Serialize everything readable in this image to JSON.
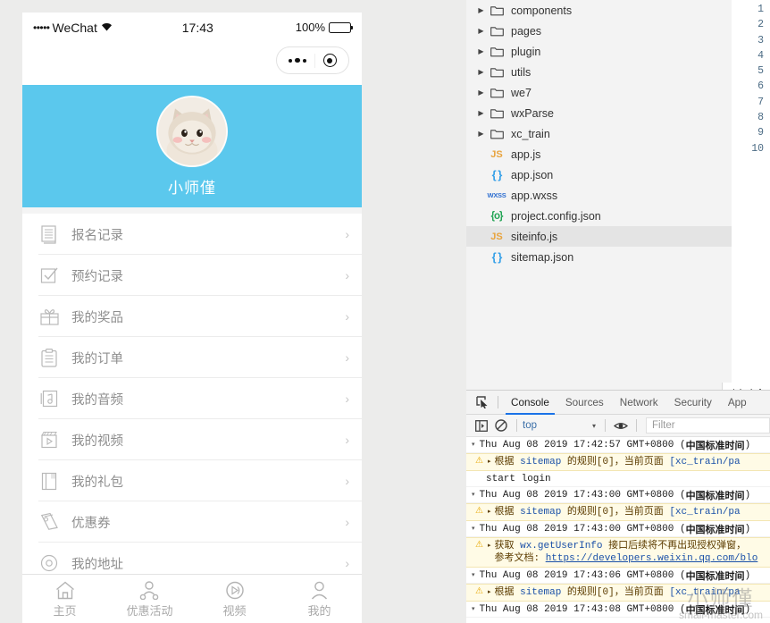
{
  "colors": {
    "accent_blue": "#5bc8ed",
    "devtools_active": "#1a73e8",
    "js_icon": "#e8a33d",
    "json_icon": "#35a0e8",
    "wxss_icon": "#2f6fd0",
    "config_icon": "#23a455",
    "warn_bg": "#fffbe6"
  },
  "phone": {
    "statusbar": {
      "signal_dots": "•••••",
      "carrier": "WeChat",
      "wifi_icon": "wifi-icon",
      "time": "17:43",
      "battery_percent": "100%",
      "battery_icon": "battery-icon"
    },
    "capsule": {
      "more_icon": "more-dots-icon",
      "target_icon": "target-circle-icon"
    },
    "profile": {
      "avatar_icon": "cat-avatar",
      "nickname": "小师僅"
    },
    "menu": [
      {
        "icon": "list-book-icon",
        "label": "报名记录",
        "arrow": "›"
      },
      {
        "icon": "checkbox-check-icon",
        "label": "预约记录",
        "arrow": "›"
      },
      {
        "icon": "gift-icon",
        "label": "我的奖品",
        "arrow": "›"
      },
      {
        "icon": "clipboard-icon",
        "label": "我的订单",
        "arrow": "›"
      },
      {
        "icon": "audio-note-icon",
        "label": "我的音频",
        "arrow": "›"
      },
      {
        "icon": "video-clapper-icon",
        "label": "我的视频",
        "arrow": "›"
      },
      {
        "icon": "gift-bag-icon",
        "label": "我的礼包",
        "arrow": "›"
      },
      {
        "icon": "coupon-icon",
        "label": "优惠券",
        "arrow": "›"
      },
      {
        "icon": "location-icon",
        "label": "我的地址",
        "arrow": "›"
      }
    ],
    "tabbar": [
      {
        "icon": "home-icon",
        "label": "主页"
      },
      {
        "icon": "people-share-icon",
        "label": "优惠活动"
      },
      {
        "icon": "video-play-icon",
        "label": "视频"
      },
      {
        "icon": "person-icon",
        "label": "我的"
      }
    ]
  },
  "ide": {
    "filetree": [
      {
        "type": "folder",
        "icon": "folder-icon",
        "name": "components",
        "expandable": true,
        "selected": false
      },
      {
        "type": "folder",
        "icon": "folder-icon",
        "name": "pages",
        "expandable": true,
        "selected": false
      },
      {
        "type": "folder",
        "icon": "folder-icon",
        "name": "plugin",
        "expandable": true,
        "selected": false
      },
      {
        "type": "folder",
        "icon": "folder-icon",
        "name": "utils",
        "expandable": true,
        "selected": false
      },
      {
        "type": "folder",
        "icon": "folder-icon",
        "name": "we7",
        "expandable": true,
        "selected": false
      },
      {
        "type": "folder",
        "icon": "folder-icon",
        "name": "wxParse",
        "expandable": true,
        "selected": false
      },
      {
        "type": "folder",
        "icon": "folder-icon",
        "name": "xc_train",
        "expandable": true,
        "selected": false
      },
      {
        "type": "js",
        "icon": "js-file-icon",
        "badge": "JS",
        "name": "app.js",
        "expandable": false,
        "selected": false
      },
      {
        "type": "json",
        "icon": "json-file-icon",
        "badge": "{ }",
        "name": "app.json",
        "expandable": false,
        "selected": false
      },
      {
        "type": "wxss",
        "icon": "wxss-file-icon",
        "badge": "WXSS",
        "name": "app.wxss",
        "expandable": false,
        "selected": false
      },
      {
        "type": "config",
        "icon": "config-file-icon",
        "badge": "{o}",
        "name": "project.config.json",
        "expandable": false,
        "selected": false
      },
      {
        "type": "js",
        "icon": "js-file-icon",
        "badge": "JS",
        "name": "siteinfo.js",
        "expandable": false,
        "selected": true
      },
      {
        "type": "json",
        "icon": "json-file-icon",
        "badge": "{ }",
        "name": "sitemap.json",
        "expandable": false,
        "selected": false
      }
    ],
    "gutter_lines": [
      "1",
      "2",
      "3",
      "4",
      "5",
      "6",
      "7",
      "8",
      "9",
      "10"
    ],
    "editor_tab": "/siteinf"
  },
  "devtools": {
    "inspect_icon": "inspect-element-icon",
    "tabs": [
      {
        "label": "Console",
        "active": true
      },
      {
        "label": "Sources",
        "active": false
      },
      {
        "label": "Network",
        "active": false
      },
      {
        "label": "Security",
        "active": false
      },
      {
        "label": "App",
        "active": false
      }
    ],
    "filterbar": {
      "sidebar_icon": "console-sidebar-icon",
      "clear_icon": "clear-console-icon",
      "context": "top",
      "context_caret": "▾",
      "eye_icon": "live-expression-icon",
      "filter_placeholder": "Filter"
    },
    "console_entries": [
      {
        "kind": "group",
        "caret": "▾",
        "date": "Thu Aug 08 2019 17:42:57 GMT+0800 (",
        "tz": "中国标准时间",
        "tail": ")"
      },
      {
        "kind": "warn",
        "icon": "warning-icon",
        "caret": "▸",
        "text_prefix": "根据 ",
        "text_code": "sitemap",
        "text_mid": " 的规则[0]，当前页面 ",
        "text_blue": "[xc_train/pa"
      },
      {
        "kind": "plain",
        "text": "start login"
      },
      {
        "kind": "group",
        "caret": "▾",
        "date": "Thu Aug 08 2019 17:43:00 GMT+0800 (",
        "tz": "中国标准时间",
        "tail": ")"
      },
      {
        "kind": "warn",
        "icon": "warning-icon",
        "caret": "▸",
        "text_prefix": "根据 ",
        "text_code": "sitemap",
        "text_mid": " 的规则[0]，当前页面 ",
        "text_blue": "[xc_train/pa"
      },
      {
        "kind": "group",
        "caret": "▾",
        "date": "Thu Aug 08 2019 17:43:00 GMT+0800 (",
        "tz": "中国标准时间",
        "tail": ")"
      },
      {
        "kind": "warn2",
        "icon": "warning-icon",
        "caret": "▸",
        "line1_prefix": "获取 ",
        "line1_code": "wx.getUserInfo",
        "line1_suffix": " 接口后续将不再出现授权弹窗，",
        "line2_label": "参考文档: ",
        "line2_link": "https://developers.weixin.qq.com/blo"
      },
      {
        "kind": "group",
        "caret": "▾",
        "date": "Thu Aug 08 2019 17:43:06 GMT+0800 (",
        "tz": "中国标准时间",
        "tail": ")"
      },
      {
        "kind": "warn",
        "icon": "warning-icon",
        "caret": "▸",
        "text_prefix": "根据 ",
        "text_code": "sitemap",
        "text_mid": " 的规则[0]，当前页面 ",
        "text_blue": "[xc_train/pa"
      },
      {
        "kind": "group",
        "caret": "▾",
        "date": "Thu Aug 08 2019 17:43:08 GMT+0800 (",
        "tz": "中国标准时间",
        "tail": ")"
      }
    ]
  },
  "watermark": {
    "cn": "小师僅",
    "en": "small-master.com"
  }
}
